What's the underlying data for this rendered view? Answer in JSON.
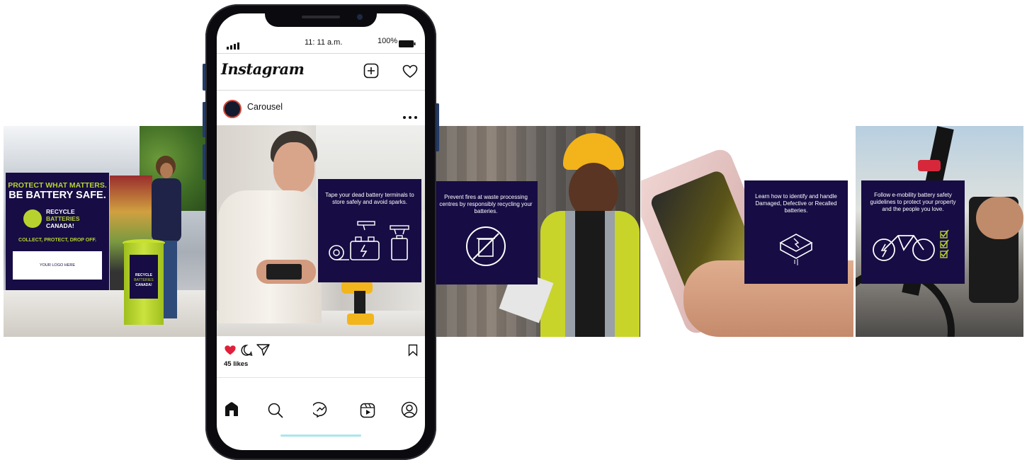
{
  "status_bar": {
    "time": "11: 11 a.m.",
    "battery": "100%"
  },
  "app": {
    "name": "Instagram"
  },
  "post": {
    "username": "Carousel",
    "likes": "45 likes"
  },
  "slides": [
    {
      "id": "slide-1",
      "headline_1": "PROTECT WHAT MATTERS.",
      "headline_2": "BE BATTERY SAFE.",
      "logo_1": "RECYCLE",
      "logo_2": "BATTERIES",
      "logo_3": "CANADA!",
      "tagline": "COLLECT, PROTECT, DROP OFF.",
      "logo_placeholder": "YOUR LOGO HERE",
      "bin_label_1": "RECYCLE",
      "bin_label_2": "BATTERIES",
      "bin_label_3": "CANADA!"
    },
    {
      "id": "slide-2",
      "text": "Tape your dead battery terminals to store safely and avoid sparks."
    },
    {
      "id": "slide-3",
      "text": "Prevent fires at waste processing centres by responsibly recycling your batteries."
    },
    {
      "id": "slide-4",
      "text": "Learn how to identify and handle Damaged, Defective or Recalled batteries."
    },
    {
      "id": "slide-5",
      "text": "Follow e-mobility battery safety guidelines to protect your property and the people you love."
    }
  ],
  "colors": {
    "navy": "#170d44",
    "lime": "#b7d22f",
    "heart": "#e0203a",
    "home_bar": "#a8e6ec"
  },
  "icons": [
    "signal-icon",
    "battery-icon",
    "new-post-icon",
    "heart-icon",
    "more-icon",
    "like-icon",
    "comment-icon",
    "share-icon",
    "bookmark-icon",
    "home-icon",
    "search-icon",
    "messenger-icon",
    "reels-icon",
    "profile-icon"
  ]
}
